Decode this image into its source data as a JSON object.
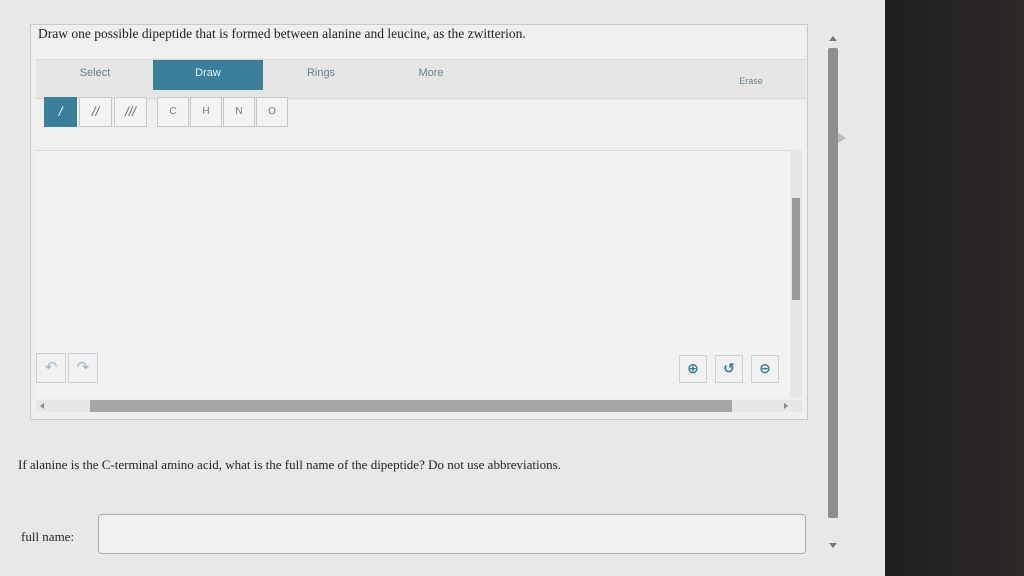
{
  "prompt": "Draw one possible dipeptide that is formed between alanine and leucine, as the zwitterion.",
  "toolbar": {
    "tabs": [
      {
        "label": "Select",
        "active": false
      },
      {
        "label": "Draw",
        "active": true
      },
      {
        "label": "Rings",
        "active": false
      },
      {
        "label": "More",
        "active": false
      }
    ],
    "erase_label": "Erase"
  },
  "bonds": [
    "/",
    "//",
    "///"
  ],
  "atoms": [
    "C",
    "H",
    "N",
    "O"
  ],
  "history": {
    "undo_icon": "undo-icon",
    "redo_icon": "redo-icon"
  },
  "zoom": {
    "zoom_in_icon": "zoom-in-icon",
    "reset_icon": "reset-zoom-icon",
    "zoom_out_icon": "zoom-out-icon"
  },
  "question2": "If alanine is the C-terminal amino acid, what is the full name of the dipeptide? Do not use abbreviations.",
  "answer": {
    "label": "full name:",
    "value": "",
    "placeholder": ""
  },
  "colors": {
    "accent": "#3a7f9b",
    "background": "#e9e8e6"
  }
}
